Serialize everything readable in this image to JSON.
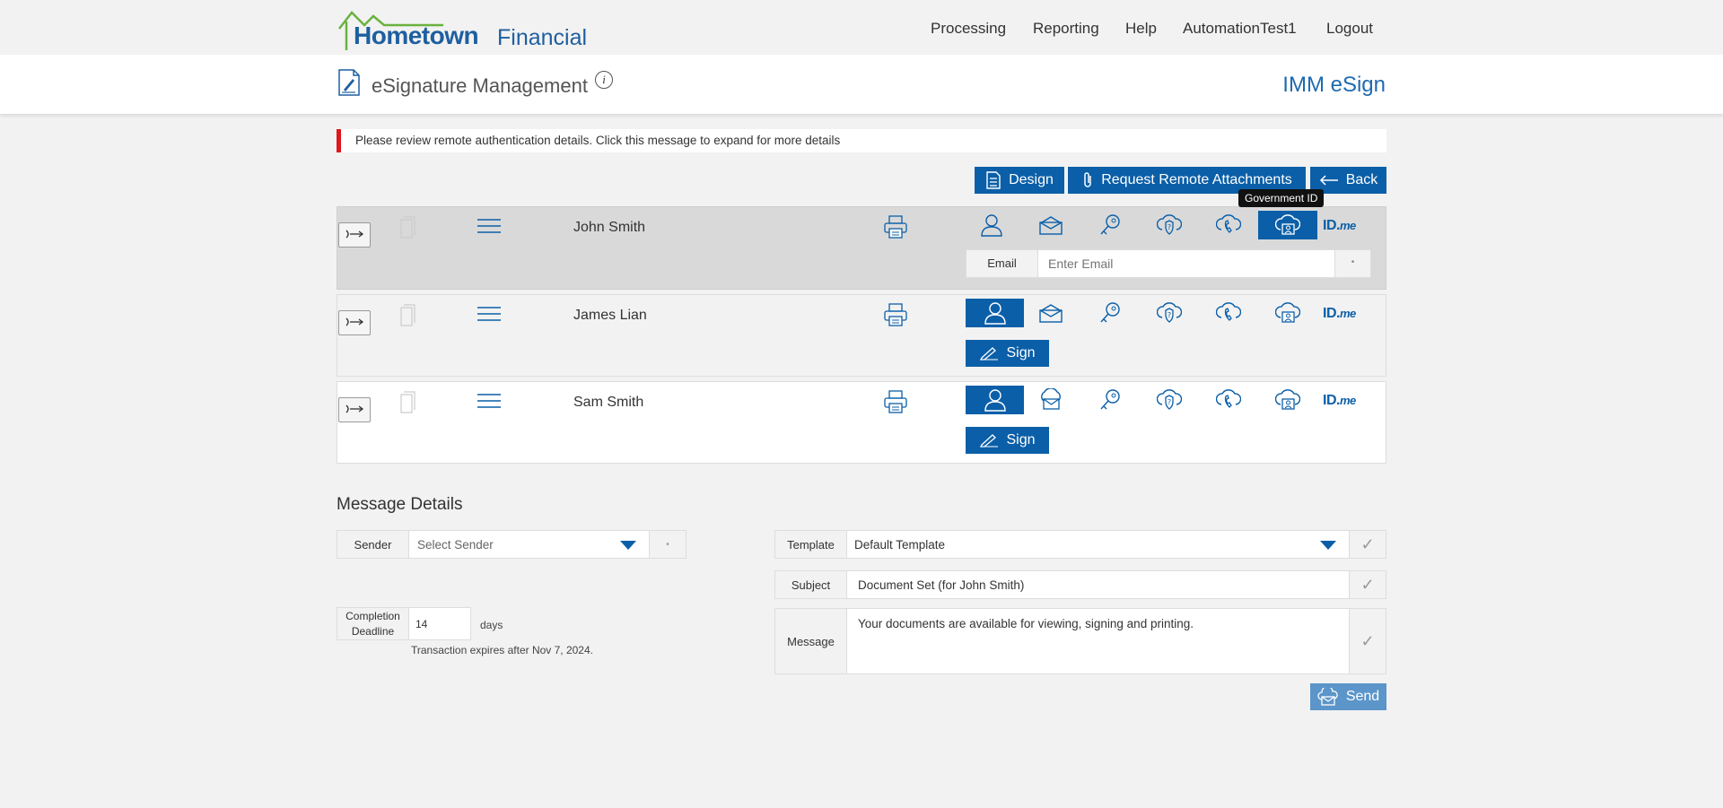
{
  "brand": {
    "name_primary": "Hometown",
    "name_secondary": "Financial"
  },
  "nav": {
    "items": [
      "Processing",
      "Reporting",
      "Help",
      "AutomationTest1",
      "Logout"
    ]
  },
  "header": {
    "title": "eSignature Management",
    "info_symbol": "i",
    "brand": "IMM eSign"
  },
  "alert": {
    "text": "Please review remote authentication details. Click this message to expand for more details"
  },
  "actions": {
    "design": "Design",
    "request_attachments": "Request Remote Attachments",
    "back": "Back"
  },
  "recipients": [
    {
      "name": "John Smith",
      "selected_auth": "government-id"
    },
    {
      "name": "James Lian",
      "selected_auth": "user",
      "sign_label": "Sign"
    },
    {
      "name": "Sam Smith",
      "selected_auth": "user",
      "sign_label": "Sign"
    }
  ],
  "auth_methods": [
    "user",
    "email",
    "key",
    "security-question",
    "phone",
    "government-id",
    "idme"
  ],
  "idme_label": {
    "main": "ID.",
    "sub": "me"
  },
  "email": {
    "label": "Email",
    "placeholder": "Enter Email",
    "dot": "•"
  },
  "tooltip": "Government ID",
  "message_details": {
    "title": "Message Details",
    "sender": {
      "label": "Sender",
      "placeholder": "Select Sender",
      "dot": "•"
    },
    "deadline": {
      "label": "Completion Deadline",
      "value": "14",
      "unit": "days",
      "expires": "Transaction expires after Nov 7, 2024."
    },
    "template": {
      "label": "Template",
      "value": "Default Template"
    },
    "subject": {
      "label": "Subject",
      "value": "Document Set (for John Smith)"
    },
    "message": {
      "label": "Message",
      "value": "Your documents are available for viewing, signing and printing."
    },
    "check": "✓",
    "send": "Send"
  },
  "colors": {
    "primary": "#0b5fa8",
    "alert": "#e0161b",
    "logo_green": "#6ab23e",
    "send_disabled": "#5b95c9"
  }
}
